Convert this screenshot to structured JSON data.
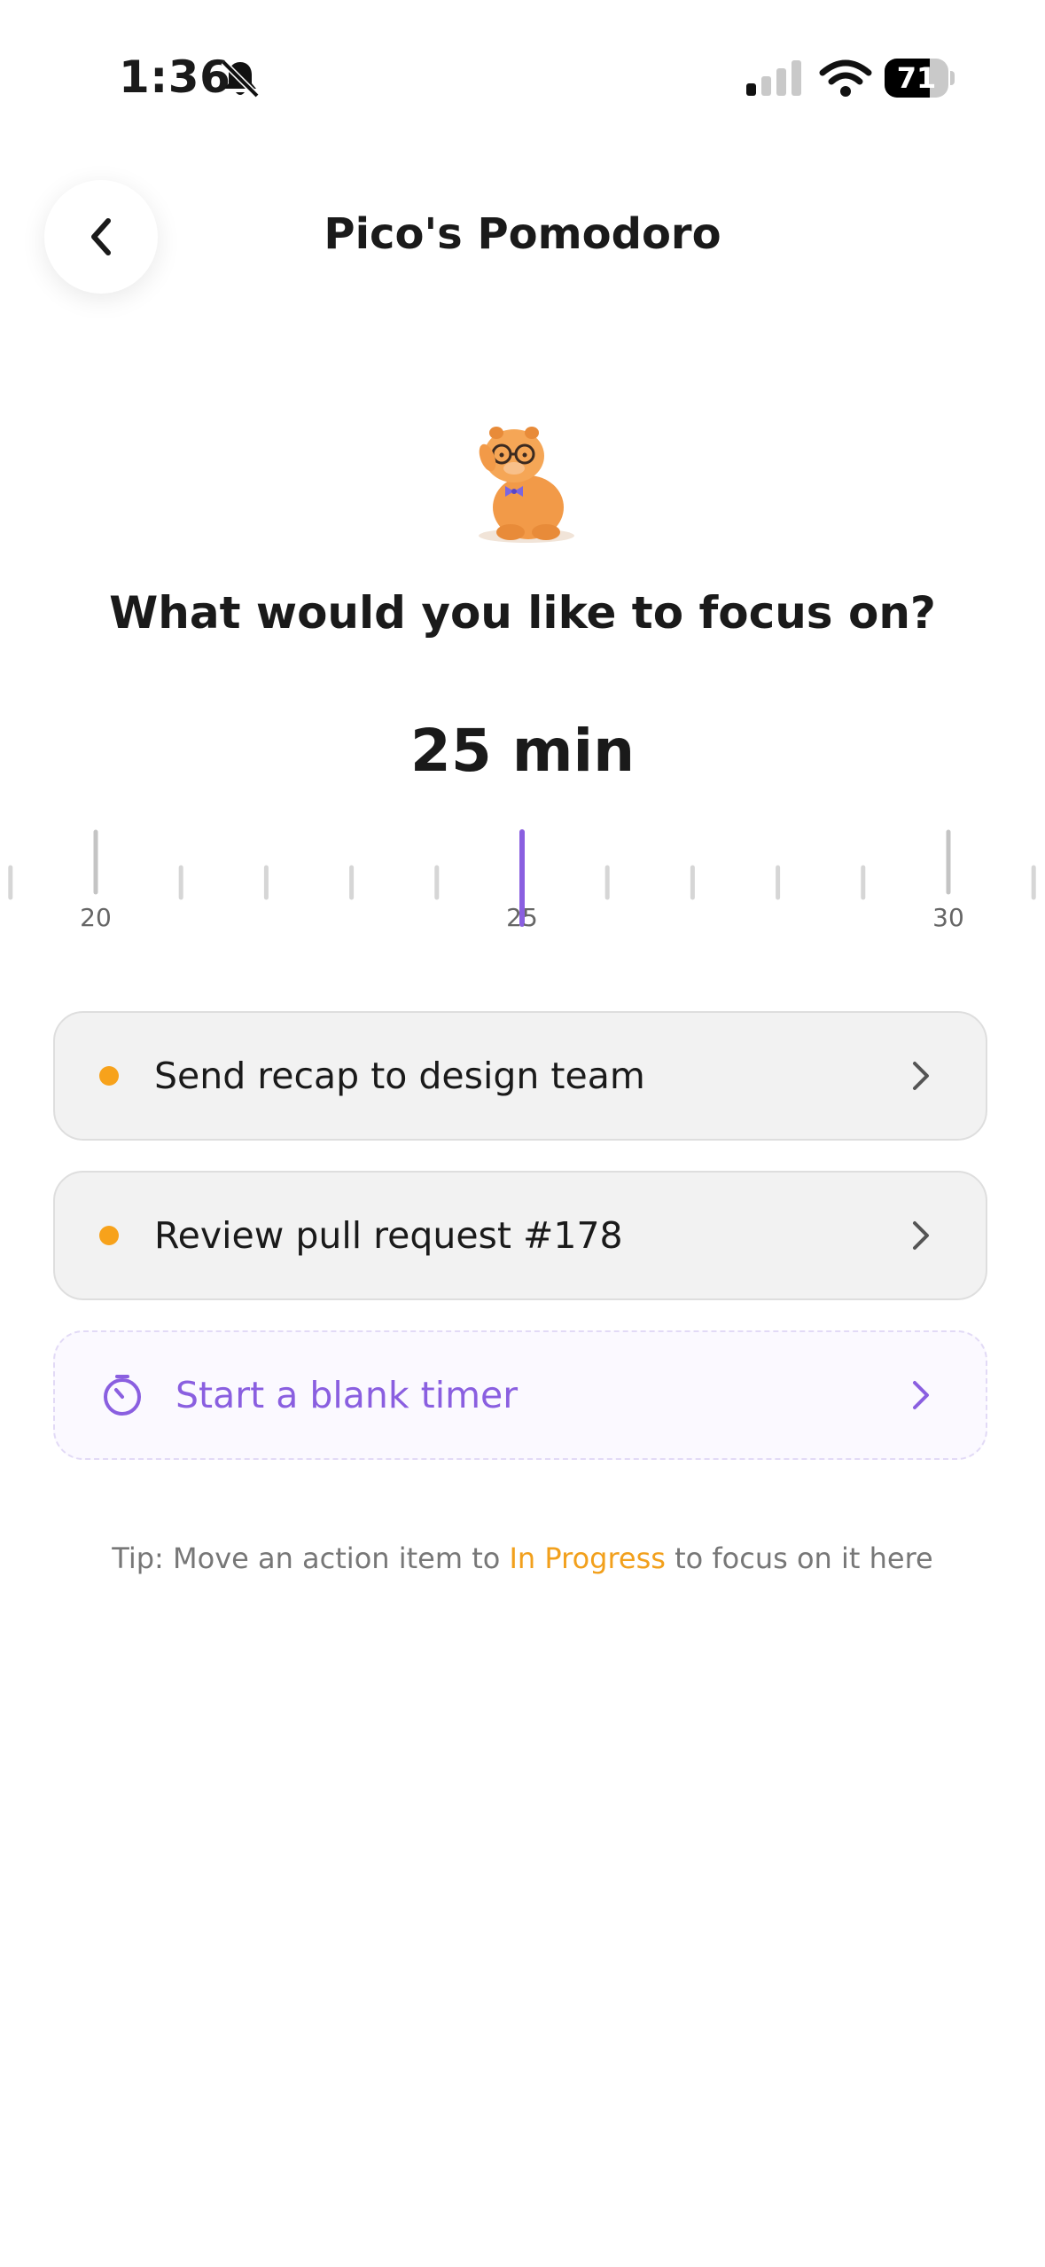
{
  "status_bar": {
    "time": "1:36",
    "battery": "71",
    "battery_level": 0.71
  },
  "header": {
    "title": "Pico's Pomodoro"
  },
  "prompt": {
    "question": "What would you like to focus on?",
    "duration": "25 min"
  },
  "ruler": {
    "labels": [
      "20",
      "25",
      "30"
    ],
    "selected": 25,
    "accent_color": "#8a5fe0"
  },
  "tasks": [
    {
      "label": "Send recap to design team",
      "status_color": "#f7a21b"
    },
    {
      "label": "Review pull request #178",
      "status_color": "#f7a21b"
    }
  ],
  "blank_timer": {
    "label": "Start a blank timer",
    "icon": "timer-icon"
  },
  "tip": {
    "prefix": "Tip: Move an action item to ",
    "highlight": "In Progress",
    "suffix": " to focus on it here"
  }
}
